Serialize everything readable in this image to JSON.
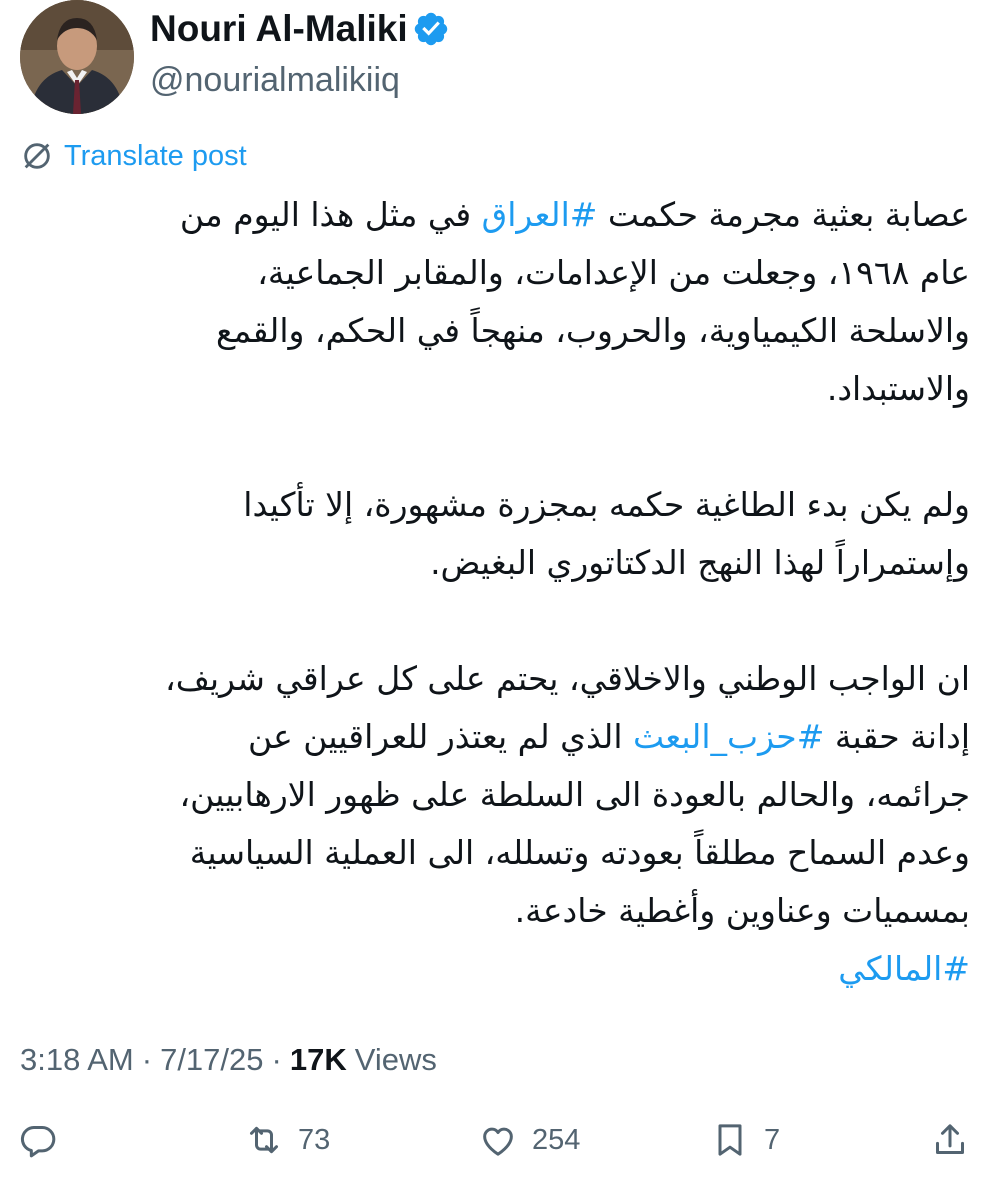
{
  "author": {
    "display_name": "Nouri Al-Maliki",
    "handle": "@nourialmalikiiq",
    "verified": true
  },
  "translate_label": "Translate post",
  "post": {
    "paragraph1": [
      {
        "text": "عصابة بعثية مجرمة حكمت "
      },
      {
        "text": "#العراق",
        "hashtag": true
      },
      {
        "text": " في مثل هذا اليوم من"
      },
      {
        "text": "عام ١٩٦٨، وجعلت من الإعدامات، والمقابر الجماعية،",
        "newline": true
      },
      {
        "text": "والاسلحة الكيمياوية، والحروب، منهجاً في الحكم، والقمع",
        "newline": true
      },
      {
        "text": "والاستبداد.",
        "newline": true
      }
    ],
    "paragraph2": [
      "ولم يكن بدء الطاغية حكمه بمجزرة مشهورة، إلا تأكيدا",
      "وإستمراراً لهذا النهج الدكتاتوري البغيض."
    ],
    "paragraph3": {
      "line1": "ان الواجب الوطني والاخلاقي، يحتم على كل عراقي شريف،",
      "line2_before": "إدانة حقبة ",
      "line2_hashtag": "#حزب_البعث",
      "line2_after": " الذي لم يعتذر للعراقيين عن",
      "line3": "جرائمه، والحالم بالعودة الى السلطة على ظهور الارهابيين،",
      "line4": "وعدم السماح مطلقاً بعودته وتسلله،  الى العملية السياسية",
      "line5": "بمسميات وعناوين وأغطية خادعة."
    },
    "closing_hashtag": "#المالكي"
  },
  "meta": {
    "time": "3:18 AM",
    "separator": "·",
    "date": "7/17/25",
    "views_count": "17K",
    "views_label": "Views"
  },
  "actions": {
    "reposts": "73",
    "likes": "254",
    "bookmarks": "7"
  },
  "colors": {
    "text": "#0f1419",
    "secondary": "#536471",
    "accent": "#1d9bf0"
  }
}
